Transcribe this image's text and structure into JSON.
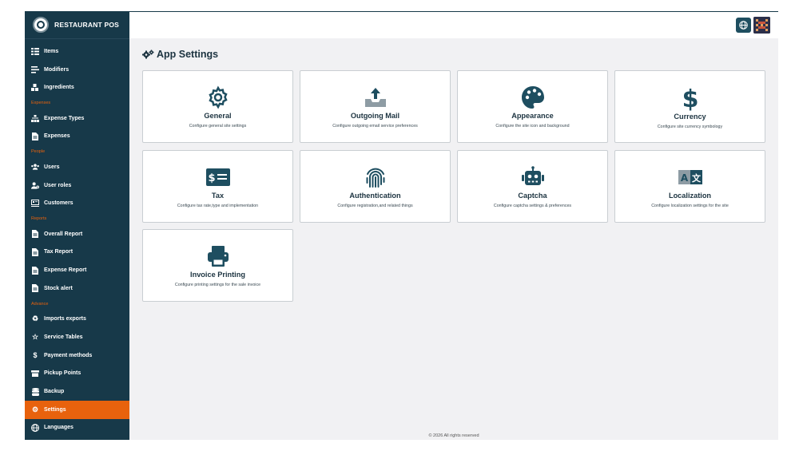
{
  "brand": {
    "name": "RESTAURANT POS"
  },
  "sidebar": {
    "items": [
      {
        "label": "Items",
        "icon": "list-icon"
      },
      {
        "label": "Modifiers",
        "icon": "lines-icon"
      },
      {
        "label": "Ingredients",
        "icon": "boxes-icon"
      },
      {
        "section": "Expenses"
      },
      {
        "label": "Expense Types",
        "icon": "sitemap-icon"
      },
      {
        "label": "Expenses",
        "icon": "document-icon"
      },
      {
        "section": "People"
      },
      {
        "label": "Users",
        "icon": "users-icon"
      },
      {
        "label": "User roles",
        "icon": "user-cog-icon"
      },
      {
        "label": "Customers",
        "icon": "customers-icon"
      },
      {
        "section": "Reports"
      },
      {
        "label": "Overall Report",
        "icon": "document-icon"
      },
      {
        "label": "Tax Report",
        "icon": "document-icon"
      },
      {
        "label": "Expense Report",
        "icon": "document-icon"
      },
      {
        "label": "Stock alert",
        "icon": "document-icon"
      },
      {
        "section": "Advance"
      },
      {
        "label": "Imports exports",
        "icon": "recycle-icon"
      },
      {
        "label": "Service Tables",
        "icon": "star-icon"
      },
      {
        "label": "Payment methods",
        "icon": "dollar-icon"
      },
      {
        "label": "Pickup Points",
        "icon": "pickup-icon"
      },
      {
        "label": "Backup",
        "icon": "database-icon"
      },
      {
        "label": "Settings",
        "icon": "gears-icon",
        "active": true
      },
      {
        "label": "Languages",
        "icon": "globe-icon"
      }
    ]
  },
  "header": {
    "language_icon": "globe-icon",
    "avatar": "user-avatar"
  },
  "page": {
    "title": "App Settings"
  },
  "cards": [
    {
      "title": "General",
      "desc": "Configure general site settings",
      "icon": "gear-icon"
    },
    {
      "title": "Outgoing Mail",
      "desc": "Configure outgoing email service preferences",
      "icon": "inbox-upload-icon"
    },
    {
      "title": "Appearance",
      "desc": "Configure the site icon and background",
      "icon": "palette-icon"
    },
    {
      "title": "Currency",
      "desc": "Configure site currency symbology",
      "icon": "dollar-icon"
    },
    {
      "title": "Tax",
      "desc": "Configure tax rate,type and implementation",
      "icon": "money-check-icon"
    },
    {
      "title": "Authentication",
      "desc": "Configure registration,and related things",
      "icon": "fingerprint-icon"
    },
    {
      "title": "Captcha",
      "desc": "Configure captcha settings & preferences",
      "icon": "robot-icon"
    },
    {
      "title": "Localization",
      "desc": "Configure localization settings for the site",
      "icon": "language-icon"
    },
    {
      "title": "Invoice Printing",
      "desc": "Configure printing settings for the sale invoice",
      "icon": "printer-icon"
    }
  ],
  "footer": {
    "text": "© 2026 All rights reserved"
  },
  "colors": {
    "sidebar": "#173949",
    "accent": "#e8620d",
    "icon": "#1e4e60"
  }
}
